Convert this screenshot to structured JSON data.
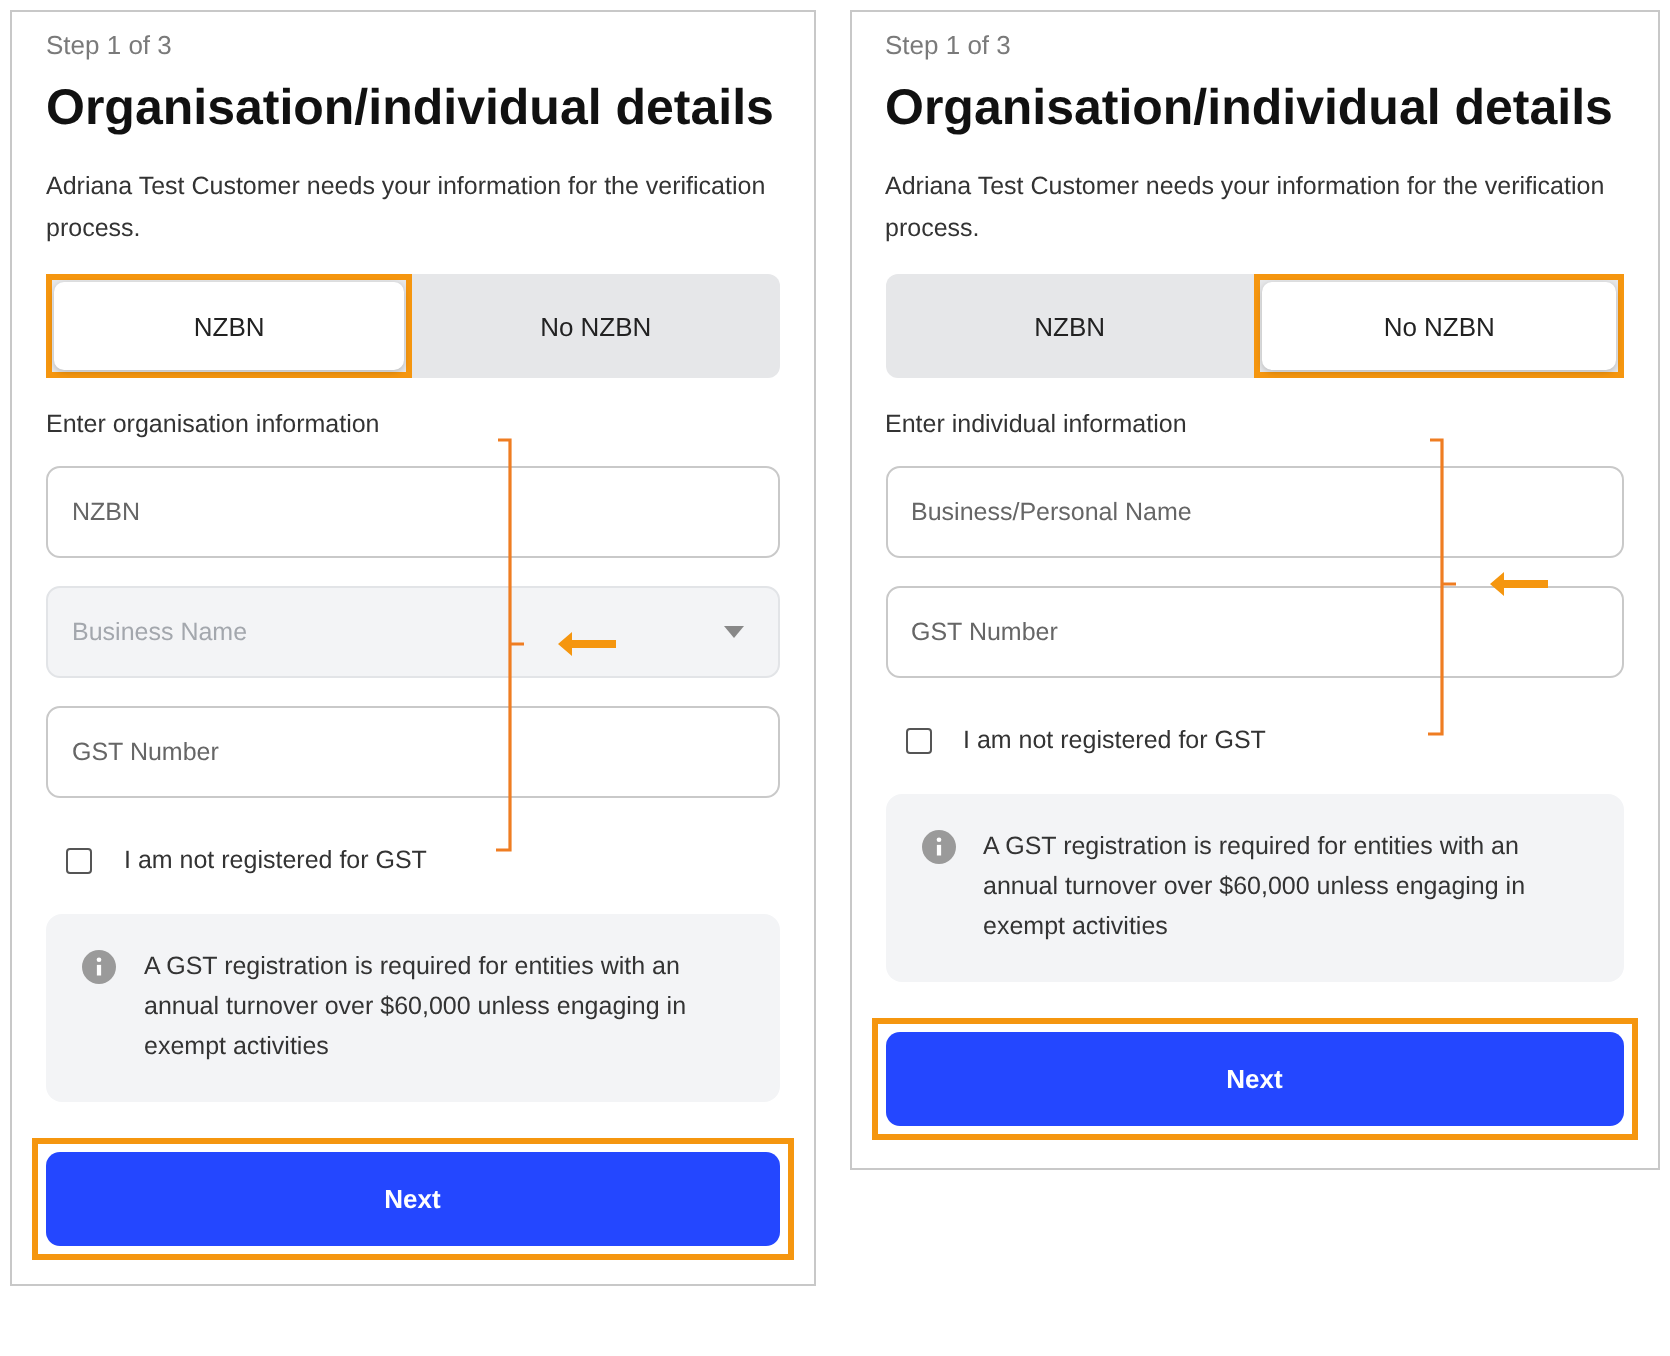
{
  "panels": [
    {
      "step": "Step 1 of 3",
      "title": "Organisation/individual details",
      "description": "Adriana Test Customer needs your information for the verification process.",
      "tabs": [
        {
          "label": "NZBN",
          "selected": true,
          "highlighted": true
        },
        {
          "label": "No NZBN",
          "selected": false,
          "highlighted": false
        }
      ],
      "section_label": "Enter organisation information",
      "fields": [
        {
          "kind": "input",
          "placeholder": "NZBN",
          "disabled": false
        },
        {
          "kind": "select",
          "placeholder": "Business Name",
          "disabled": true
        },
        {
          "kind": "input",
          "placeholder": "GST Number",
          "disabled": false
        }
      ],
      "checkbox": {
        "label": "I am not registered for GST",
        "checked": false
      },
      "info": "A GST registration is required for entities with an annual turnover over $60,000 unless engaging in exempt activities",
      "next_button": {
        "label": "Next",
        "highlighted": true
      }
    },
    {
      "step": "Step 1 of 3",
      "title": "Organisation/individual details",
      "description": "Adriana Test Customer needs your information for the verification process.",
      "tabs": [
        {
          "label": "NZBN",
          "selected": false,
          "highlighted": false
        },
        {
          "label": "No NZBN",
          "selected": true,
          "highlighted": true
        }
      ],
      "section_label": "Enter individual information",
      "fields": [
        {
          "kind": "input",
          "placeholder": "Business/Personal Name",
          "disabled": false
        },
        {
          "kind": "input",
          "placeholder": "GST Number",
          "disabled": false
        }
      ],
      "checkbox": {
        "label": "I am not registered for GST",
        "checked": false
      },
      "info": "A GST registration is required for entities with an annual turnover over $60,000 unless engaging in exempt activities",
      "next_button": {
        "label": "Next",
        "highlighted": true
      }
    }
  ]
}
